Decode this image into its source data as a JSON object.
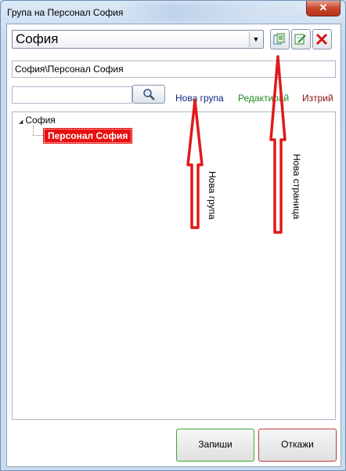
{
  "window": {
    "title": "Група на Персонал София",
    "close_glyph": "✕"
  },
  "toolbar": {
    "combo_value": "София",
    "combo_arrow_icon": "dropdown-arrow-icon",
    "buttons": [
      {
        "name": "new-page-button",
        "icon": "document-copy-icon"
      },
      {
        "name": "edit-button",
        "icon": "edit-pencil-icon"
      },
      {
        "name": "delete-button",
        "icon": "red-x-icon"
      }
    ]
  },
  "path_field": {
    "value": "София\\Персонал София"
  },
  "search": {
    "value": "",
    "icon": "magnifier-icon"
  },
  "links": {
    "new_group": "Нова група",
    "edit": "Редактирай",
    "delete": "Изтрий"
  },
  "tree": {
    "root_label": "София",
    "child_label": "Персонал София"
  },
  "footer": {
    "save_label": "Запиши",
    "cancel_label": "Откажи"
  },
  "annotations": {
    "arrow_color": "#e01a1a",
    "label_new_group": "Нова група",
    "label_new_page": "Нова страница"
  }
}
